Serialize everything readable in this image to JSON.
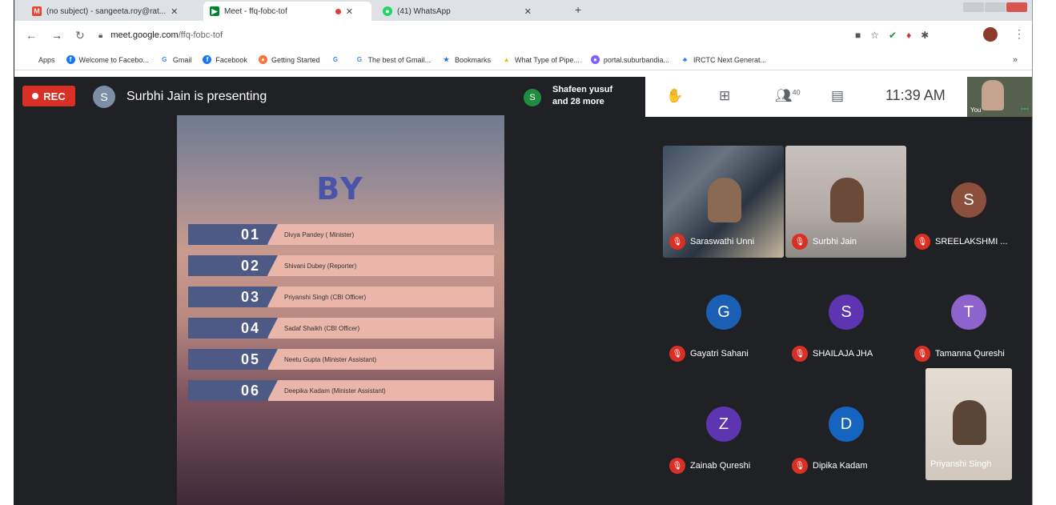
{
  "browser": {
    "tabs": [
      {
        "label": "(no subject) - sangeeta.roy@rat...",
        "favicon": "gmail-icon"
      },
      {
        "label": "Meet - ffq-fobc-tof",
        "favicon": "meet-icon"
      },
      {
        "label": "(41) WhatsApp",
        "favicon": "whatsapp-icon"
      }
    ],
    "new_tab": "+",
    "address": {
      "host": "meet.google.com",
      "path": "/ffq-fobc-tof"
    },
    "bookmarks": [
      {
        "label": "Apps",
        "color": "#4285f4"
      },
      {
        "label": "Welcome to Facebo...",
        "color": "#1877f2"
      },
      {
        "label": "Gmail",
        "color": "#ea4335"
      },
      {
        "label": "Facebook",
        "color": "#1877f2"
      },
      {
        "label": "Getting Started",
        "color": "#ff7139"
      },
      {
        "label": "G",
        "color": "#4285f4"
      },
      {
        "label": "The best of Gmail...",
        "color": "#4285f4"
      },
      {
        "label": "Bookmarks",
        "color": "#1a73e8"
      },
      {
        "label": "What Type of Pipe...",
        "color": "#f4b400"
      },
      {
        "label": "portal.suburbandia...",
        "color": "#7b61ff"
      },
      {
        "label": "IRCTC Next Generat...",
        "color": "#1a73e8"
      }
    ],
    "more": "»"
  },
  "meet": {
    "rec_label": "REC",
    "presenter_initial": "S",
    "presenting_text": "Surbhi Jain is presenting",
    "chip_initial": "S",
    "chip_line1": "Shafeen yusuf",
    "chip_line2": "and 28 more",
    "participant_count": "40",
    "clock": "11:39 AM",
    "self_label": "You",
    "accent": "#d93025"
  },
  "slide": {
    "heading": "BY",
    "rows": [
      {
        "num": "01",
        "text": "Divya Pandey ( Minister)"
      },
      {
        "num": "02",
        "text": "Shivani Dubey (Reporter)"
      },
      {
        "num": "03",
        "text": "Priyanshi Singh (CBI Officer)"
      },
      {
        "num": "04",
        "text": "Sadaf Shaikh  (CBI Officer)"
      },
      {
        "num": "05",
        "text": "Neetu Gupta (Minister Assistant)"
      },
      {
        "num": "06",
        "text": "Deepika Kadam (Minister Assistant)"
      }
    ]
  },
  "participants": [
    {
      "name": "Saraswathi Unni",
      "initial": "",
      "color": "",
      "video": true
    },
    {
      "name": "Surbhi Jain",
      "initial": "",
      "color": "",
      "video": true
    },
    {
      "name": "SREELAKSHMI ...",
      "initial": "S",
      "color": "#8d4f3d",
      "video": false
    },
    {
      "name": "Gayatri Sahani",
      "initial": "G",
      "color": "#1a5fb4",
      "video": false
    },
    {
      "name": "SHAILAJA JHA",
      "initial": "S",
      "color": "#5e35b1",
      "video": false
    },
    {
      "name": "Tamanna Qureshi",
      "initial": "T",
      "color": "#8e63ce",
      "video": false
    },
    {
      "name": "Zainab Qureshi",
      "initial": "Z",
      "color": "#5e35b1",
      "video": false
    },
    {
      "name": "Dipika Kadam",
      "initial": "D",
      "color": "#1565c0",
      "video": false
    },
    {
      "name": "Priyanshi Singh",
      "initial": "",
      "color": "",
      "video": true
    }
  ]
}
